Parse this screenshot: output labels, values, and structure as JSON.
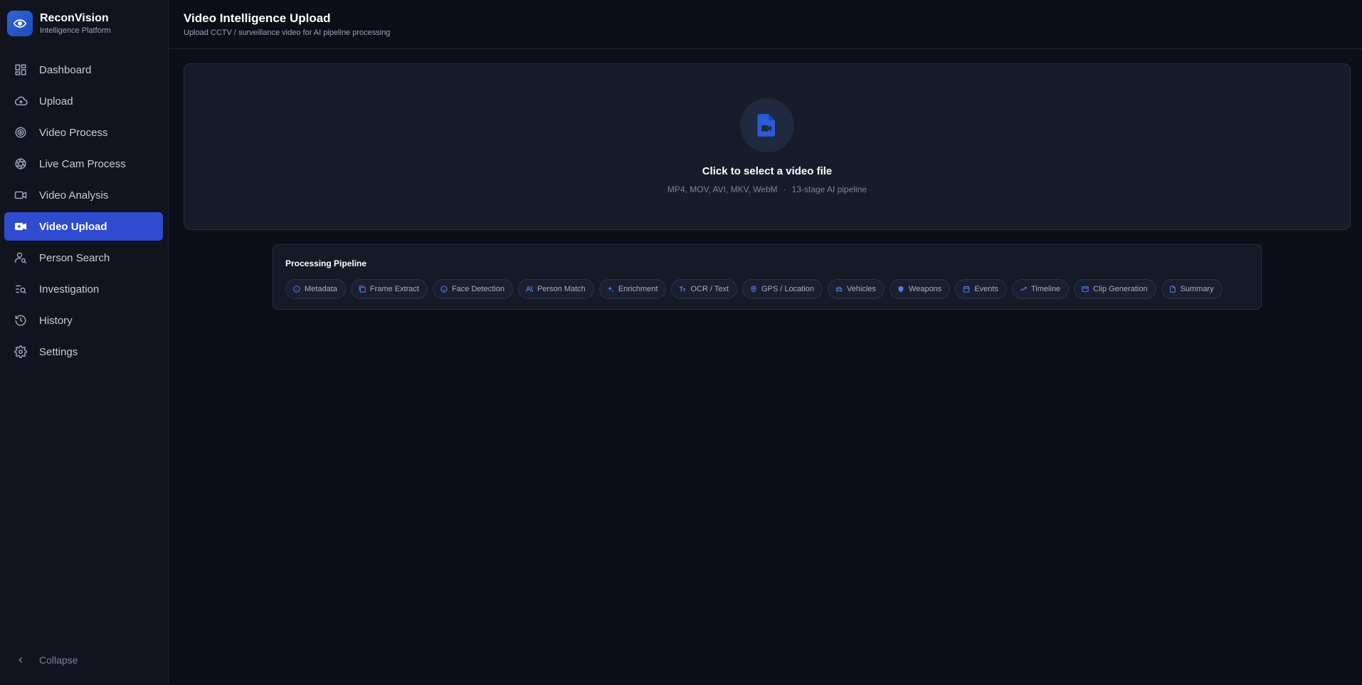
{
  "brand": {
    "title": "ReconVision",
    "subtitle": "Intelligence Platform",
    "logo_icon": "eye-icon"
  },
  "sidebar": {
    "items": [
      {
        "label": "Dashboard",
        "icon": "dashboard-icon"
      },
      {
        "label": "Upload",
        "icon": "cloud-upload-icon"
      },
      {
        "label": "Video Process",
        "icon": "target-icon"
      },
      {
        "label": "Live Cam Process",
        "icon": "aperture-icon"
      },
      {
        "label": "Video Analysis",
        "icon": "video-camera-icon"
      },
      {
        "label": "Video Upload",
        "icon": "video-upload-icon",
        "active": true
      },
      {
        "label": "Person Search",
        "icon": "person-search-icon"
      },
      {
        "label": "Investigation",
        "icon": "list-search-icon"
      },
      {
        "label": "History",
        "icon": "history-icon"
      },
      {
        "label": "Settings",
        "icon": "gear-icon"
      }
    ],
    "collapse_label": "Collapse"
  },
  "header": {
    "title": "Video Intelligence Upload",
    "subtitle": "Upload CCTV / surveillance video for AI pipeline processing"
  },
  "dropzone": {
    "title": "Click to select a video file",
    "formats": "MP4, MOV, AVI, MKV, WebM",
    "separator": "·",
    "pipeline_note": "13-stage AI pipeline",
    "icon": "video-file-icon"
  },
  "pipeline": {
    "title": "Processing Pipeline",
    "stages": [
      {
        "label": "Metadata",
        "icon": "info-icon"
      },
      {
        "label": "Frame Extract",
        "icon": "frames-icon"
      },
      {
        "label": "Face Detection",
        "icon": "face-icon"
      },
      {
        "label": "Person Match",
        "icon": "users-icon"
      },
      {
        "label": "Enrichment",
        "icon": "sparkles-icon"
      },
      {
        "label": "OCR / Text",
        "icon": "text-icon"
      },
      {
        "label": "GPS / Location",
        "icon": "map-pin-icon"
      },
      {
        "label": "Vehicles",
        "icon": "car-icon"
      },
      {
        "label": "Weapons",
        "icon": "shield-icon"
      },
      {
        "label": "Events",
        "icon": "calendar-icon"
      },
      {
        "label": "Timeline",
        "icon": "trend-icon"
      },
      {
        "label": "Clip Generation",
        "icon": "clip-icon"
      },
      {
        "label": "Summary",
        "icon": "document-icon"
      }
    ]
  },
  "colors": {
    "accent": "#2f4bcf",
    "chip_icon": "#4f7df0",
    "background": "#0c0f18"
  }
}
